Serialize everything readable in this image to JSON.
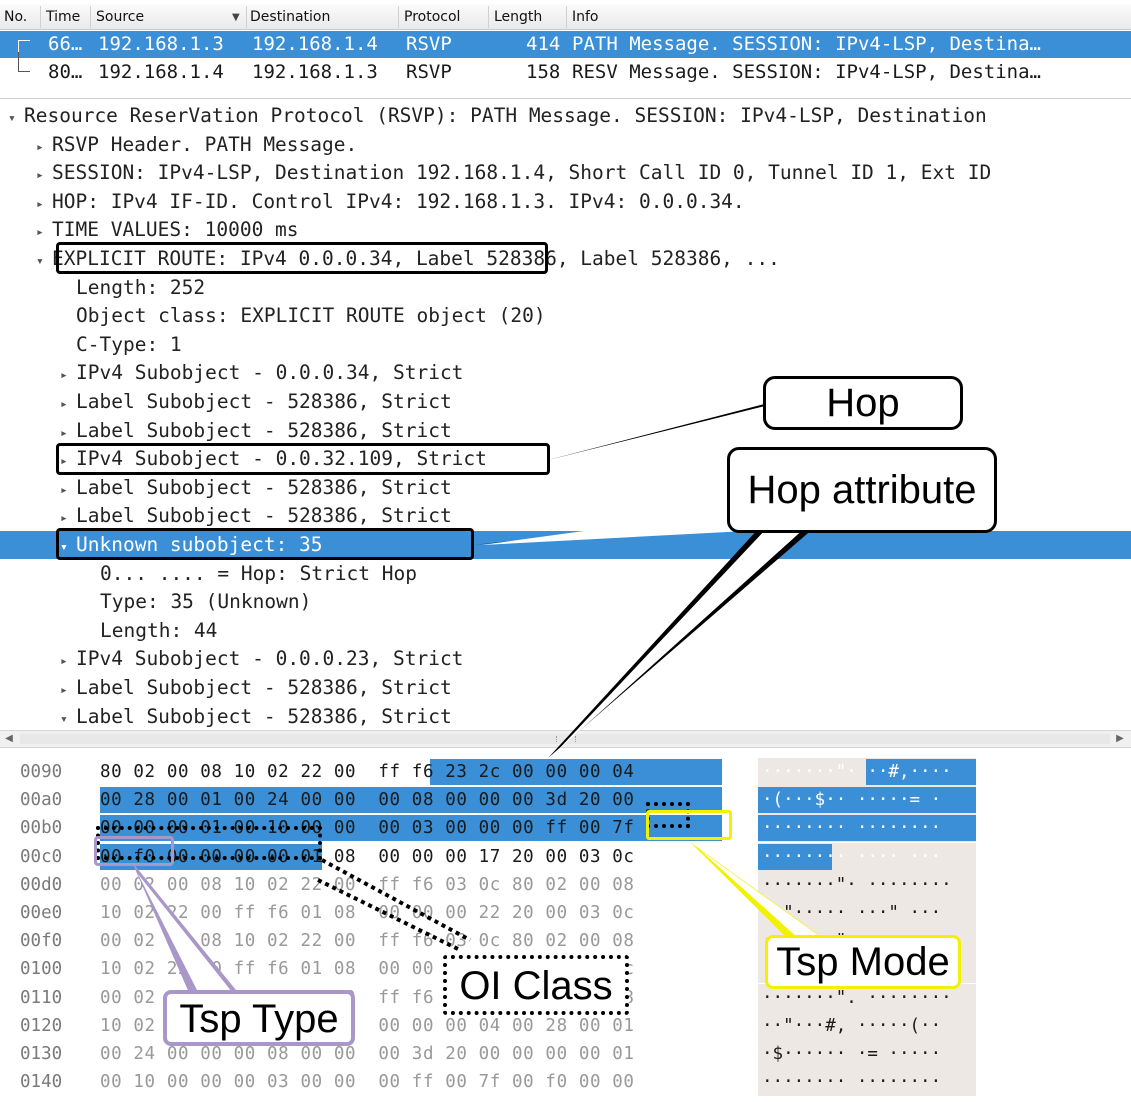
{
  "packet_list": {
    "columns": [
      "No.",
      "Time",
      "Source",
      "Destination",
      "Protocol",
      "Length",
      "Info"
    ],
    "rows": [
      {
        "no": "66…",
        "source": "192.168.1.3",
        "destination": "192.168.1.4",
        "protocol": "RSVP",
        "length": "414",
        "info": "PATH Message. SESSION: IPv4-LSP, Destina…",
        "selected": true
      },
      {
        "no": "80…",
        "source": "192.168.1.4",
        "destination": "192.168.1.3",
        "protocol": "RSVP",
        "length": "158",
        "info": "RESV Message. SESSION: IPv4-LSP, Destina…",
        "selected": false
      }
    ]
  },
  "details": [
    {
      "indent": 0,
      "arrow": "open",
      "text": "Resource ReserVation Protocol (RSVP): PATH Message. SESSION: IPv4-LSP, Destination"
    },
    {
      "indent": 1,
      "arrow": "closed",
      "text": "RSVP Header. PATH Message."
    },
    {
      "indent": 1,
      "arrow": "closed",
      "text": "SESSION: IPv4-LSP, Destination 192.168.1.4, Short Call ID 0, Tunnel ID 1, Ext ID"
    },
    {
      "indent": 1,
      "arrow": "closed",
      "text": "HOP: IPv4 IF-ID. Control IPv4: 192.168.1.3. IPv4: 0.0.0.34."
    },
    {
      "indent": 1,
      "arrow": "closed",
      "text": "TIME VALUES: 10000 ms"
    },
    {
      "indent": 1,
      "arrow": "open",
      "text": "EXPLICIT ROUTE: IPv4 0.0.0.34, Label 528386, Label 528386, ..."
    },
    {
      "indent": 2,
      "arrow": "none",
      "text": "Length: 252"
    },
    {
      "indent": 2,
      "arrow": "none",
      "text": "Object class: EXPLICIT ROUTE object (20)"
    },
    {
      "indent": 2,
      "arrow": "none",
      "text": "C-Type: 1"
    },
    {
      "indent": 2,
      "arrow": "closed",
      "text": "IPv4 Subobject - 0.0.0.34, Strict"
    },
    {
      "indent": 2,
      "arrow": "closed",
      "text": "Label Subobject - 528386, Strict"
    },
    {
      "indent": 2,
      "arrow": "closed",
      "text": "Label Subobject - 528386, Strict"
    },
    {
      "indent": 2,
      "arrow": "closed",
      "text": "IPv4 Subobject - 0.0.32.109, Strict"
    },
    {
      "indent": 2,
      "arrow": "closed",
      "text": "Label Subobject - 528386, Strict"
    },
    {
      "indent": 2,
      "arrow": "closed",
      "text": "Label Subobject - 528386, Strict"
    },
    {
      "indent": 2,
      "arrow": "open",
      "text": "Unknown subobject: 35",
      "selected": true
    },
    {
      "indent": 3,
      "arrow": "none",
      "text": "0... .... = Hop: Strict Hop"
    },
    {
      "indent": 3,
      "arrow": "none",
      "text": "Type: 35 (Unknown)"
    },
    {
      "indent": 3,
      "arrow": "none",
      "text": "Length: 44"
    },
    {
      "indent": 2,
      "arrow": "closed",
      "text": "IPv4 Subobject - 0.0.0.23, Strict"
    },
    {
      "indent": 2,
      "arrow": "closed",
      "text": "Label Subobject - 528386, Strict"
    },
    {
      "indent": 2,
      "arrow": "open",
      "text": "Label Subobject - 528386, Strict"
    }
  ],
  "bytes": [
    {
      "offset": "0090",
      "hex": "80 02 00 08 10 02 22 00  ff f6 23 2c 00 00 00 04",
      "ascii": "·······\"· ··#,····"
    },
    {
      "offset": "00a0",
      "hex": "00 28 00 01 00 24 00 00  00 08 00 00 00 3d 20 00",
      "ascii": "·(···$·· ·····= ·"
    },
    {
      "offset": "00b0",
      "hex": "00 00 00 01 00 10 00 00  00 03 00 00 00 ff 00 7f",
      "ascii": "········ ········"
    },
    {
      "offset": "00c0",
      "hex": "00 f0 00 00 00 00 01 08  00 00 00 17 20 00 03 0c",
      "ascii": "········ ···· ···"
    },
    {
      "offset": "00d0",
      "hex": "00 02 00 08 10 02 22 00  ff f6 03 0c 80 02 00 08",
      "ascii": "·······\"· ········"
    },
    {
      "offset": "00e0",
      "hex": "10 02 22 00 ff f6 01 08  00 00 00 22 20 00 03 0c",
      "ascii": "··\"····· ···\" ···"
    },
    {
      "offset": "00f0",
      "hex": "00 02 00 08 10 02 22 00  ff f6 03 0c 80 02 00 08",
      "ascii": "·······\"· ········"
    },
    {
      "offset": "0100",
      "hex": "10 02 22 00 ff f6 01 08  00 00 00 22 20 00 03 0c",
      "ascii": "··\"····· ···\" ···"
    },
    {
      "offset": "0110",
      "hex": "00 02 00 08 10 02 22 00  ff f6 03 0c 80 02 00 08",
      "ascii": "·······\". ········"
    },
    {
      "offset": "0120",
      "hex": "10 02 22 00 ff f6 23 2c  00 00 00 04 00 28 00 01",
      "ascii": "··\"···#, ·····(··"
    },
    {
      "offset": "0130",
      "hex": "00 24 00 00 00 08 00 00  00 3d 20 00 00 00 00 01",
      "ascii": "·$······ ·= ·····"
    },
    {
      "offset": "0140",
      "hex": "00 10 00 00 00 03 00 00  00 ff 00 7f 00 f0 00 00",
      "ascii": "········ ········"
    }
  ],
  "annotations": {
    "hop": "Hop",
    "hop_attribute": "Hop attribute",
    "tsp_mode": "Tsp Mode",
    "oi_class": "OI Class",
    "tsp_type": "Tsp Type"
  },
  "colors": {
    "selection": "#3a8fd6",
    "tsp_mode": "#f2f200",
    "tsp_type": "#a897c8",
    "ascii_bg": "#eee8e4"
  }
}
